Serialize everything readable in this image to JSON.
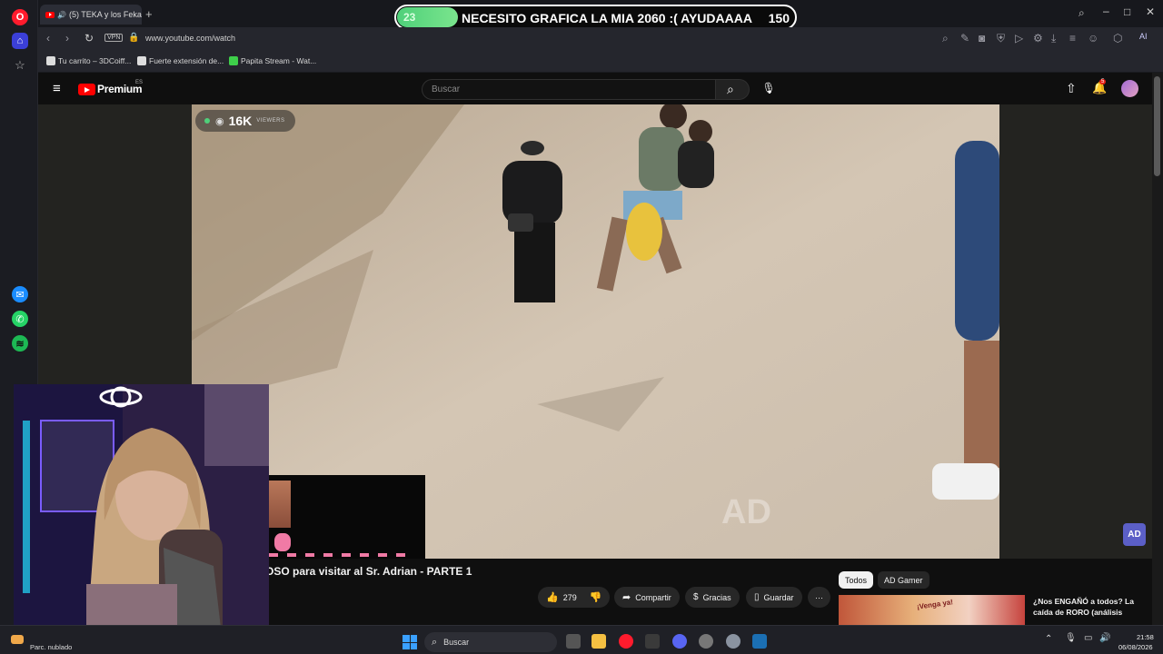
{
  "browser": {
    "tab_title": "(5) TEKA y los Fekas v",
    "vpn_label": "VPN",
    "url": "www.youtube.com/watch",
    "bookmarks": [
      "Tu carrito – 3DCoiff...",
      "Fuerte extensión de...",
      "Papita Stream - Wat..."
    ]
  },
  "overlay": {
    "goal_current": "23",
    "goal_text": "NECESITO GRAFICA LA MIA 2060 :( AYUDAAAA",
    "goal_target": "150",
    "goal_progress_fraction": 0.153
  },
  "youtube": {
    "logo_text": "Premium",
    "logo_region": "ES",
    "search_placeholder": "Buscar",
    "notification_count": "5",
    "viewers_count": "16K",
    "viewers_label": "VIEWERS",
    "video_title": "OSO para visitar al Sr. Adrian - PARTE 1",
    "watermark": "AD",
    "like_count": "279",
    "share_label": "Compartir",
    "thanks_label": "Gracias",
    "save_label": "Guardar",
    "more_label": "···",
    "chips": [
      "Todos",
      "AD Gamer"
    ],
    "rec_title_1": "¿Nos ENGAÑÓ a todos? La",
    "rec_title_2": "caída de RORO (análisis",
    "rec_thumb_text": "¡Venga ya!"
  },
  "taskbar": {
    "weather": "Parc. nublado",
    "search_label": "Buscar",
    "time": "21:58",
    "date": "06/08/2026"
  },
  "colors": {
    "accent_green": "#4fd07a",
    "yt_red": "#ff0000",
    "opera_red": "#ff1b2d"
  }
}
